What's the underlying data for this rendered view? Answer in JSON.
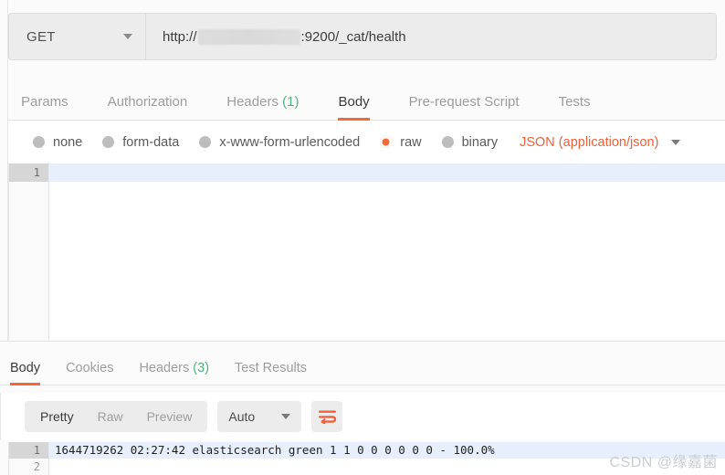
{
  "request": {
    "method": "GET",
    "method_caret_icon": "chevron-down-icon",
    "url_prefix": "http://",
    "url_redacted": "",
    "url_suffix": ":9200/_cat/health",
    "tabs": [
      {
        "label": "Params",
        "count": "",
        "active": false
      },
      {
        "label": "Authorization",
        "count": "",
        "active": false
      },
      {
        "label": "Headers",
        "count": "(1)",
        "active": false
      },
      {
        "label": "Body",
        "count": "",
        "active": true
      },
      {
        "label": "Pre-request Script",
        "count": "",
        "active": false
      },
      {
        "label": "Tests",
        "count": "",
        "active": false
      }
    ],
    "body_types": [
      {
        "label": "none",
        "selected": false
      },
      {
        "label": "form-data",
        "selected": false
      },
      {
        "label": "x-www-form-urlencoded",
        "selected": false
      },
      {
        "label": "raw",
        "selected": true
      },
      {
        "label": "binary",
        "selected": false
      }
    ],
    "content_type": "JSON (application/json)",
    "content_type_caret_icon": "chevron-down-icon",
    "editor_lines": [
      {
        "number": "1",
        "text": "",
        "active": true
      }
    ]
  },
  "response": {
    "tabs": [
      {
        "label": "Body",
        "count": "",
        "active": true
      },
      {
        "label": "Cookies",
        "count": "",
        "active": false
      },
      {
        "label": "Headers",
        "count": "(3)",
        "active": false
      },
      {
        "label": "Test Results",
        "count": "",
        "active": false
      }
    ],
    "view_modes": [
      {
        "label": "Pretty",
        "active": true
      },
      {
        "label": "Raw",
        "active": false
      },
      {
        "label": "Preview",
        "active": false
      }
    ],
    "format": "Auto",
    "format_caret_icon": "chevron-down-icon",
    "wrap_icon": "wrap-text-icon",
    "body_lines": [
      {
        "number": "1",
        "text": "1644719262 02:27:42 elasticsearch green 1 1 0 0 0 0 0 0 - 100.0%",
        "active": true
      },
      {
        "number": "2",
        "text": "",
        "active": false
      }
    ]
  },
  "watermark": "CSDN @缘嘉菌",
  "colors": {
    "accent": "#f06a35",
    "count_green": "#45b97c",
    "active_line": "#e6effb"
  }
}
